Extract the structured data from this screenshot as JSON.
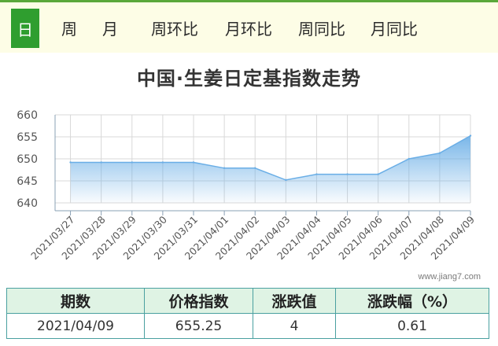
{
  "tabs": [
    "日",
    "周",
    "月",
    "周环比",
    "月环比",
    "周同比",
    "月同比"
  ],
  "active_tab": "日",
  "colors": {
    "accent": "#2f9e2f",
    "line": "#6aaee6",
    "area_top": "#6aaee6",
    "grid": "#d8d8d8"
  },
  "watermark": "www.jiang7.com",
  "table": {
    "headers": [
      "期数",
      "价格指数",
      "涨跌值",
      "涨跌幅（%）"
    ],
    "row": [
      "2021/04/09",
      "655.25",
      "4",
      "0.61"
    ]
  },
  "chart_data": {
    "type": "area",
    "title": "中国·生姜日定基指数走势",
    "categories": [
      "2021/03/27",
      "2021/03/28",
      "2021/03/29",
      "2021/03/30",
      "2021/03/31",
      "2021/04/01",
      "2021/04/02",
      "2021/04/03",
      "2021/04/04",
      "2021/04/05",
      "2021/04/06",
      "2021/04/07",
      "2021/04/08",
      "2021/04/09"
    ],
    "series": [
      {
        "values": [
          649.2,
          649.2,
          649.2,
          649.2,
          649.2,
          647.9,
          647.9,
          645.2,
          646.5,
          646.5,
          646.5,
          650.0,
          651.3,
          655.25
        ]
      }
    ],
    "ylim": [
      640,
      660
    ],
    "yticks": [
      640,
      645,
      650,
      655,
      660
    ],
    "grid": true,
    "xlabel": "",
    "ylabel": ""
  }
}
